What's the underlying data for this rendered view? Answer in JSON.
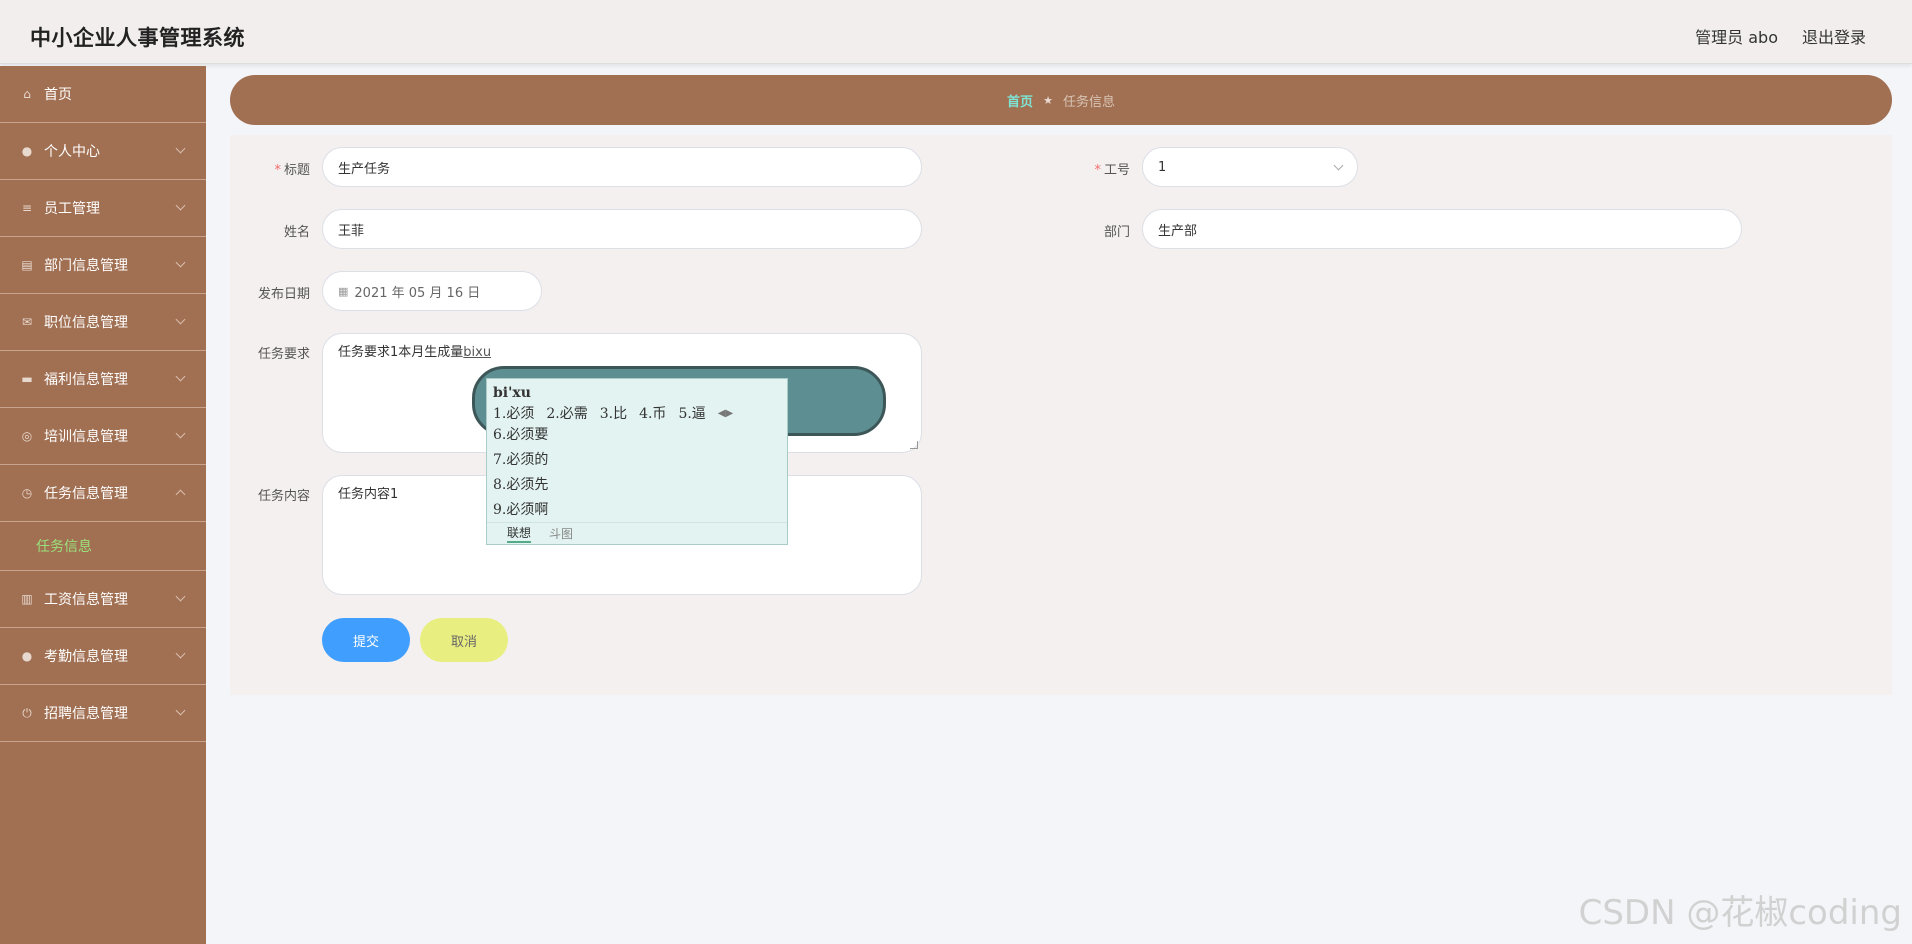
{
  "header": {
    "title": "中小企业人事管理系统",
    "user": "管理员 abo",
    "logout": "退出登录"
  },
  "sidebar": {
    "items": [
      {
        "label": "首页",
        "icon": "home-icon"
      },
      {
        "label": "个人中心",
        "icon": "user-icon"
      },
      {
        "label": "员工管理",
        "icon": "list-icon"
      },
      {
        "label": "部门信息管理",
        "icon": "doc-icon"
      },
      {
        "label": "职位信息管理",
        "icon": "mail-icon"
      },
      {
        "label": "福利信息管理",
        "icon": "stack-icon"
      },
      {
        "label": "培训信息管理",
        "icon": "compass-icon"
      },
      {
        "label": "任务信息管理",
        "icon": "clock-icon"
      },
      {
        "label": "工资信息管理",
        "icon": "chart-icon"
      },
      {
        "label": "考勤信息管理",
        "icon": "user-icon"
      },
      {
        "label": "招聘信息管理",
        "icon": "power-icon"
      }
    ],
    "sub_item": "任务信息"
  },
  "breadcrumb": {
    "home": "首页",
    "current": "任务信息"
  },
  "form": {
    "title_label": "标题",
    "title_value": "生产任务",
    "gonghao_label": "工号",
    "gonghao_value": "1",
    "name_label": "姓名",
    "name_value": "王菲",
    "dept_label": "部门",
    "dept_value": "生产部",
    "date_label": "发布日期",
    "date_value": "2021 年 05 月 16 日",
    "req_label": "任务要求",
    "req_value": "任务要求1本月生成量",
    "req_composing": "bixu",
    "content_label": "任务内容",
    "content_value": "任务内容1",
    "submit": "提交",
    "cancel": "取消"
  },
  "ime": {
    "pinyin": "bi'xu",
    "row": [
      "1.必须",
      "2.必需",
      "3.比",
      "4.币",
      "5.逼"
    ],
    "more": [
      "6.必须要",
      "7.必须的",
      "8.必须先",
      "9.必须啊"
    ],
    "tab_assoc": "联想",
    "tab_meme": "斗图"
  },
  "watermark": "CSDN @花椒coding",
  "colors": {
    "sidebar": "#a16f52",
    "submit": "#409eff",
    "cancel": "#e8ee80",
    "accent": "#9be07c"
  }
}
